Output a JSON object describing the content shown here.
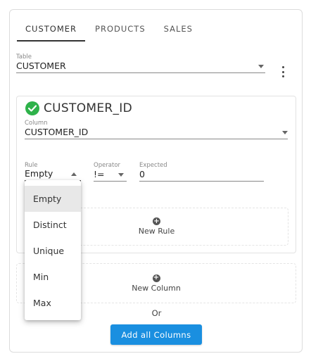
{
  "tabs": [
    {
      "label": "CUSTOMER",
      "active": true
    },
    {
      "label": "PRODUCTS",
      "active": false
    },
    {
      "label": "SALES",
      "active": false
    }
  ],
  "table_field": {
    "label": "Table",
    "value": "CUSTOMER"
  },
  "column_card": {
    "title": "CUSTOMER_ID",
    "column_field": {
      "label": "Column",
      "value": "CUSTOMER_ID"
    },
    "rule_field": {
      "label": "Rule",
      "value": "Empty"
    },
    "operator_field": {
      "label": "Operator",
      "value": "!="
    },
    "expected_field": {
      "label": "Expected",
      "value": "0"
    },
    "new_rule_label": "New Rule"
  },
  "new_column_label": "New Column",
  "or_text": "Or",
  "add_all_label": "Add all Columns",
  "rule_options": [
    "Empty",
    "Distinct",
    "Unique",
    "Min",
    "Max"
  ],
  "rule_selected": "Empty",
  "colors": {
    "accent": "#1a8fe0",
    "success": "#2eb24a"
  },
  "icons": [
    "check-circle-icon",
    "plus-circle-icon",
    "more-vert-icon",
    "caret-down-icon",
    "caret-up-icon"
  ]
}
